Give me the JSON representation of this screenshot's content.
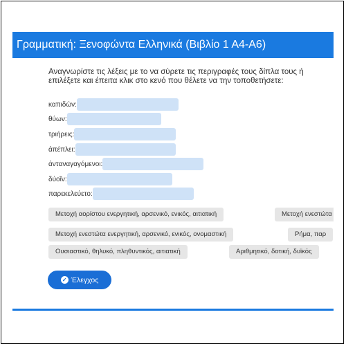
{
  "header": {
    "title": "Γραμματική: Ξενοφώντα Ελληνικά (Βιβλίο 1 Α4-Α6)"
  },
  "instructions": {
    "line1": "Αναγνωρίστε τις λέξεις με το να σύρετε τις περιγραφές τους δίπλα τους ή",
    "line2": "επιλέξετε και έπειτα κλικ στο κενό που θέλετε να την τοποθετήσετε:"
  },
  "words": [
    {
      "label": "καπιδών:"
    },
    {
      "label": "θύων:"
    },
    {
      "label": "τριήρεις:"
    },
    {
      "label": "ἀπέπλει:"
    },
    {
      "label": "ἀνταναγαγόμενοι:"
    },
    {
      "label": "δύοῖν:"
    },
    {
      "label": "παρεκελεύετο:"
    }
  ],
  "options": [
    {
      "label": "Μετοχή αορίστου ενεργητική, αρσενικό, ενικός, αιτιατική"
    },
    {
      "label": "Μετοχή ενεστώτα"
    },
    {
      "label": "Μετοχή ενεστώτα ενεργητική, αρσενικό, ενικός, ονομαστική"
    },
    {
      "label": "Ρήμα, παρ"
    },
    {
      "label": "Ουσιαστικό, θηλυκό, πληθυντικός, αιτιατική"
    },
    {
      "label": "Αριθμητικό, δοτική, δυϊκός"
    }
  ],
  "check_button": {
    "label": "Έλεγχος",
    "icon": "check-circle-icon"
  },
  "colors": {
    "accent": "#1a7ae0",
    "drop_zone": "#cfe2f7",
    "chip": "#e6e6e6"
  }
}
